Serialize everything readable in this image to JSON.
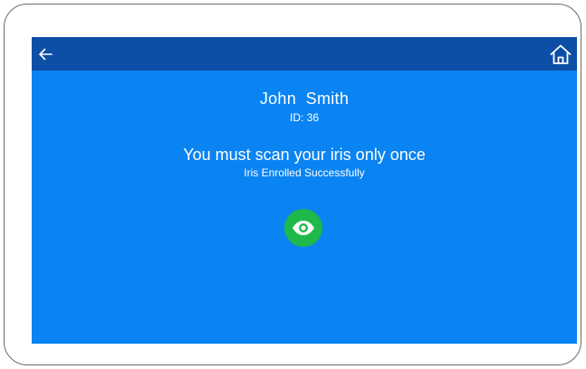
{
  "header": {
    "back_icon": "arrow-left-icon",
    "home_icon": "home-icon"
  },
  "user": {
    "name": "John  Smith",
    "id_text": "ID: 36"
  },
  "message": {
    "instruction": "You must scan your iris only once",
    "status": "Iris Enrolled Successfully"
  },
  "status_indicator": {
    "icon": "eye-icon",
    "color": "#1fb84a"
  },
  "colors": {
    "screen_background": "#0a84f2",
    "top_bar": "#0d4ea6",
    "text": "#ffffff"
  }
}
